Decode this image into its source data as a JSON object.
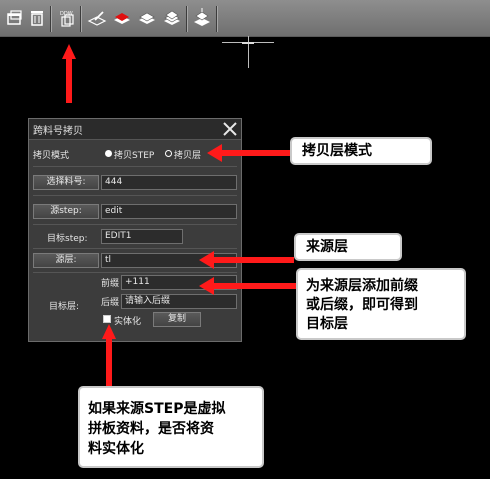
{
  "toolbar": {
    "buttons": [
      {
        "name": "window-icon"
      },
      {
        "name": "delete-icon"
      },
      {
        "name": "ddw-copy-icon",
        "label": "DDW"
      },
      {
        "name": "layer-edit-icon"
      },
      {
        "name": "layer-red-icon"
      },
      {
        "name": "layers-icon"
      },
      {
        "name": "layers-stack-icon"
      },
      {
        "name": "layer-copy-icon"
      }
    ]
  },
  "dialog": {
    "title": "跨料号拷贝",
    "copy_mode_label": "拷贝模式",
    "mode_options": [
      "拷贝STEP",
      "拷贝层"
    ],
    "select_job_button": "选择料号:",
    "job_value": "444",
    "source_step_button": "源step:",
    "source_step_value": "edit",
    "target_step_label": "目标step:",
    "target_step_value": "EDIT1",
    "source_layer_button": "源层:",
    "source_layer_value": "tl",
    "target_layer_label": "目标层:",
    "prefix_label": "前缀",
    "prefix_value": "+111",
    "suffix_label": "后缀",
    "suffix_placeholder": "请输入后缀",
    "solidify_label": "实体化",
    "copy_button": "复制"
  },
  "callouts": {
    "copy_layer_mode": "拷贝层模式",
    "source_layer": "来源层",
    "prefix_suffix": [
      "为来源层添加前缀",
      "或后缀，即可得到",
      "目标层"
    ],
    "solidify": [
      "如果来源STEP是虚拟",
      "拼板资料，是否将资",
      "料实体化"
    ]
  },
  "colors": {
    "arrow": "#ff1a1a",
    "dialog_bg": "#3c3c3c",
    "toolbar": "#7d7d7d"
  }
}
